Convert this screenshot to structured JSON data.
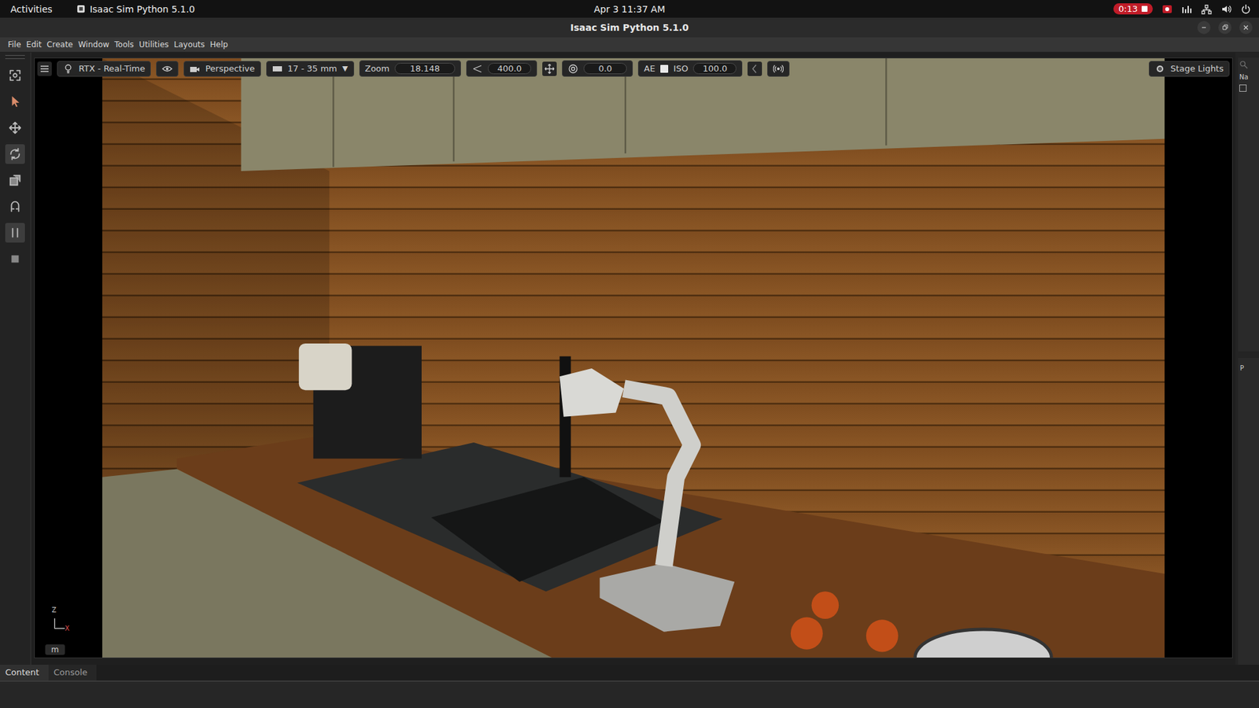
{
  "top_bar": {
    "activities": "Activities",
    "app_name": "Isaac Sim Python 5.1.0",
    "clock": "Apr 3 11:37 AM",
    "recording": "0:13"
  },
  "window": {
    "title": "Isaac Sim Python 5.1.0"
  },
  "menu": [
    "File",
    "Edit",
    "Create",
    "Window",
    "Tools",
    "Utilities",
    "Layouts",
    "Help"
  ],
  "tools": [
    {
      "selected": false
    },
    {
      "selected": false
    },
    {
      "selected": false
    },
    {
      "selected": true
    },
    {
      "selected": false
    },
    {
      "selected": false
    },
    {
      "selected": true
    },
    {
      "selected": false
    }
  ],
  "viewport_toolbar": {
    "renderer": "RTX - Real-Time",
    "camera": "Perspective",
    "lens": "17 - 35 mm",
    "lens_arrow": "▼",
    "zoom_label": "Zoom",
    "zoom": "18.148",
    "speed": "400.0",
    "exposure": "0.0",
    "ae_label": "AE",
    "ae_checked": false,
    "iso_label": "ISO",
    "iso": "100.0",
    "lights": "Stage Lights"
  },
  "gizmo": {
    "z": "Z",
    "x": "X"
  },
  "units": "m",
  "right_panel": {
    "header": "Na",
    "tab": "P"
  },
  "bottom_tabs": [
    {
      "label": "Content",
      "selected": true
    },
    {
      "label": "Console",
      "selected": false
    }
  ]
}
